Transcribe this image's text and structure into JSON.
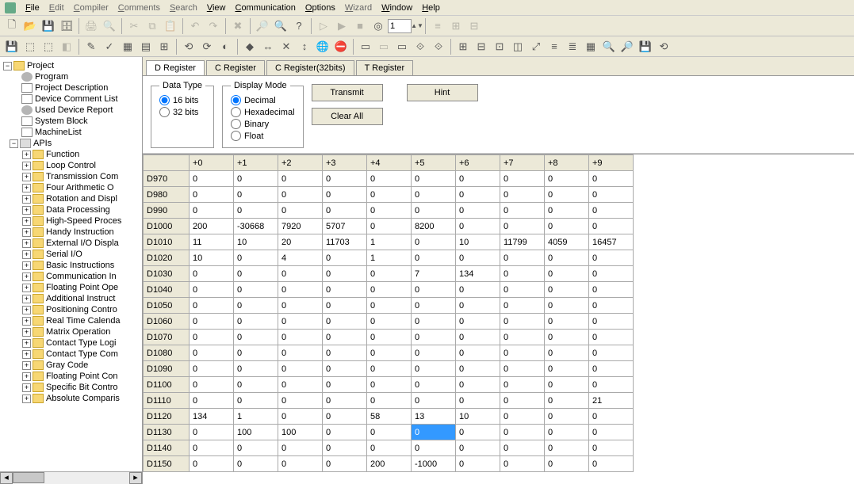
{
  "menu": [
    "File",
    "Edit",
    "Compiler",
    "Comments",
    "Search",
    "View",
    "Communication",
    "Options",
    "Wizard",
    "Window",
    "Help"
  ],
  "menu_active": [
    0,
    5,
    6,
    7,
    9,
    10
  ],
  "toolbar_spin_value": "1",
  "sidebar": {
    "root": "Project",
    "items": [
      {
        "label": "Program",
        "icon": "gear",
        "exp": "none"
      },
      {
        "label": "Project Description",
        "icon": "doc",
        "exp": "none"
      },
      {
        "label": "Device Comment List",
        "icon": "doc",
        "exp": "none"
      },
      {
        "label": "Used Device Report",
        "icon": "gear",
        "exp": "none"
      },
      {
        "label": "System Block",
        "icon": "doc",
        "exp": "none"
      },
      {
        "label": "MachineList",
        "icon": "doc",
        "exp": "none"
      }
    ],
    "apis_label": "APIs",
    "apis": [
      "Function",
      "Loop Control",
      "Transmission Com",
      "Four Arithmetic O",
      "Rotation and Displ",
      "Data Processing",
      "High-Speed Proces",
      "Handy Instruction",
      "External I/O Displa",
      "Serial I/O",
      "Basic Instructions",
      "Communication In",
      "Floating Point Ope",
      "Additional Instruct",
      "Positioning Contro",
      "Real Time Calenda",
      "Matrix Operation",
      "Contact Type Logi",
      "Contact Type Com",
      "Gray Code",
      "Floating Point Con",
      "Specific Bit Contro",
      "Absolute Comparis"
    ]
  },
  "tabs": [
    "D Register",
    "C Register",
    "C Register(32bits)",
    "T Register"
  ],
  "active_tab": 0,
  "groups": {
    "data_type": {
      "legend": "Data Type",
      "options": [
        "16 bits",
        "32 bits"
      ],
      "selected": 0
    },
    "display_mode": {
      "legend": "Display Mode",
      "options": [
        "Decimal",
        "Hexadecimal",
        "Binary",
        "Float"
      ],
      "selected": 0
    }
  },
  "buttons": {
    "transmit": "Transmit",
    "hint": "Hint",
    "clear_all": "Clear All"
  },
  "grid": {
    "col_headers": [
      "+0",
      "+1",
      "+2",
      "+3",
      "+4",
      "+5",
      "+6",
      "+7",
      "+8",
      "+9"
    ],
    "rows": [
      {
        "hdr": "D970",
        "cells": [
          "0",
          "0",
          "0",
          "0",
          "0",
          "0",
          "0",
          "0",
          "0",
          "0"
        ]
      },
      {
        "hdr": "D980",
        "cells": [
          "0",
          "0",
          "0",
          "0",
          "0",
          "0",
          "0",
          "0",
          "0",
          "0"
        ]
      },
      {
        "hdr": "D990",
        "cells": [
          "0",
          "0",
          "0",
          "0",
          "0",
          "0",
          "0",
          "0",
          "0",
          "0"
        ]
      },
      {
        "hdr": "D1000",
        "cells": [
          "200",
          "-30668",
          "7920",
          "5707",
          "0",
          "8200",
          "0",
          "0",
          "0",
          "0"
        ]
      },
      {
        "hdr": "D1010",
        "cells": [
          "11",
          "10",
          "20",
          "11703",
          "1",
          "0",
          "10",
          "11799",
          "4059",
          "16457"
        ]
      },
      {
        "hdr": "D1020",
        "cells": [
          "10",
          "0",
          "4",
          "0",
          "1",
          "0",
          "0",
          "0",
          "0",
          "0"
        ]
      },
      {
        "hdr": "D1030",
        "cells": [
          "0",
          "0",
          "0",
          "0",
          "0",
          "7",
          "134",
          "0",
          "0",
          "0"
        ]
      },
      {
        "hdr": "D1040",
        "cells": [
          "0",
          "0",
          "0",
          "0",
          "0",
          "0",
          "0",
          "0",
          "0",
          "0"
        ]
      },
      {
        "hdr": "D1050",
        "cells": [
          "0",
          "0",
          "0",
          "0",
          "0",
          "0",
          "0",
          "0",
          "0",
          "0"
        ]
      },
      {
        "hdr": "D1060",
        "cells": [
          "0",
          "0",
          "0",
          "0",
          "0",
          "0",
          "0",
          "0",
          "0",
          "0"
        ]
      },
      {
        "hdr": "D1070",
        "cells": [
          "0",
          "0",
          "0",
          "0",
          "0",
          "0",
          "0",
          "0",
          "0",
          "0"
        ]
      },
      {
        "hdr": "D1080",
        "cells": [
          "0",
          "0",
          "0",
          "0",
          "0",
          "0",
          "0",
          "0",
          "0",
          "0"
        ]
      },
      {
        "hdr": "D1090",
        "cells": [
          "0",
          "0",
          "0",
          "0",
          "0",
          "0",
          "0",
          "0",
          "0",
          "0"
        ]
      },
      {
        "hdr": "D1100",
        "cells": [
          "0",
          "0",
          "0",
          "0",
          "0",
          "0",
          "0",
          "0",
          "0",
          "0"
        ]
      },
      {
        "hdr": "D1110",
        "cells": [
          "0",
          "0",
          "0",
          "0",
          "0",
          "0",
          "0",
          "0",
          "0",
          "21"
        ]
      },
      {
        "hdr": "D1120",
        "cells": [
          "134",
          "1",
          "0",
          "0",
          "58",
          "13",
          "10",
          "0",
          "0",
          "0"
        ]
      },
      {
        "hdr": "D1130",
        "cells": [
          "0",
          "100",
          "100",
          "0",
          "0",
          "0",
          "0",
          "0",
          "0",
          "0"
        ]
      },
      {
        "hdr": "D1140",
        "cells": [
          "0",
          "0",
          "0",
          "0",
          "0",
          "0",
          "0",
          "0",
          "0",
          "0"
        ]
      },
      {
        "hdr": "D1150",
        "cells": [
          "0",
          "0",
          "0",
          "0",
          "200",
          "-1000",
          "0",
          "0",
          "0",
          "0"
        ]
      }
    ],
    "selected": {
      "row": 16,
      "col": 5
    }
  }
}
